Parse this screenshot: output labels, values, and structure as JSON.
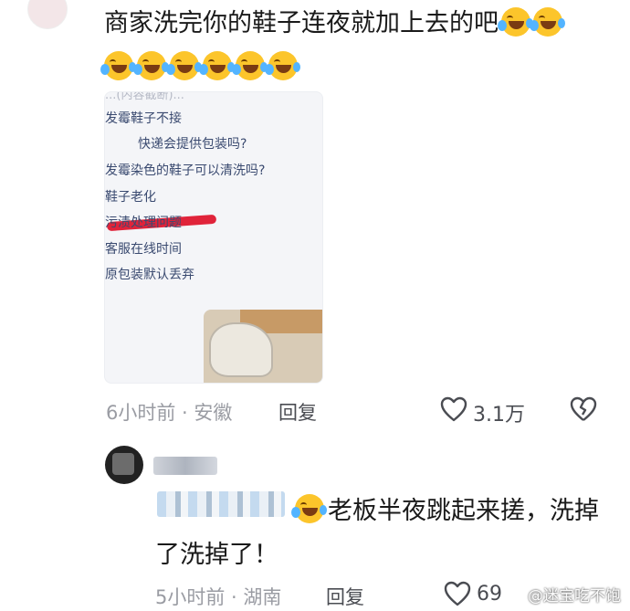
{
  "comment": {
    "text": "商家洗完你的鞋子连夜就加上去的吧",
    "inline_emojis": [
      "laugh-cry-emoji",
      "laugh-cry-emoji"
    ],
    "emoji_row": [
      "laugh-cry-emoji",
      "laugh-cry-emoji",
      "laugh-cry-emoji",
      "laugh-cry-emoji",
      "laugh-cry-emoji",
      "laugh-cry-emoji"
    ],
    "screenshot": {
      "top_partial": "...(内容截断)...",
      "lines": [
        "发霉鞋子不接",
        "快递会提供包装吗?",
        "发霉染色的鞋子可以清洗吗?",
        "鞋子老化",
        "污渍处理问题",
        "客服在线时间",
        "原包装默认丢弃"
      ]
    },
    "time": "6小时前",
    "location": "安徽",
    "reply_label": "回复",
    "likes": "3.1万"
  },
  "reply": {
    "text": "老板半夜跳起来搓，洗掉了洗掉了！",
    "time": "5小时前",
    "location": "湖南",
    "reply_label": "回复",
    "likes": "69"
  },
  "watermark": "@迷宝吃不饱",
  "colors": {
    "meta": "#9a9ca3",
    "text": "#1a1a1a",
    "emoji": "#fcc52b",
    "highlight_line": "#e0233a"
  }
}
